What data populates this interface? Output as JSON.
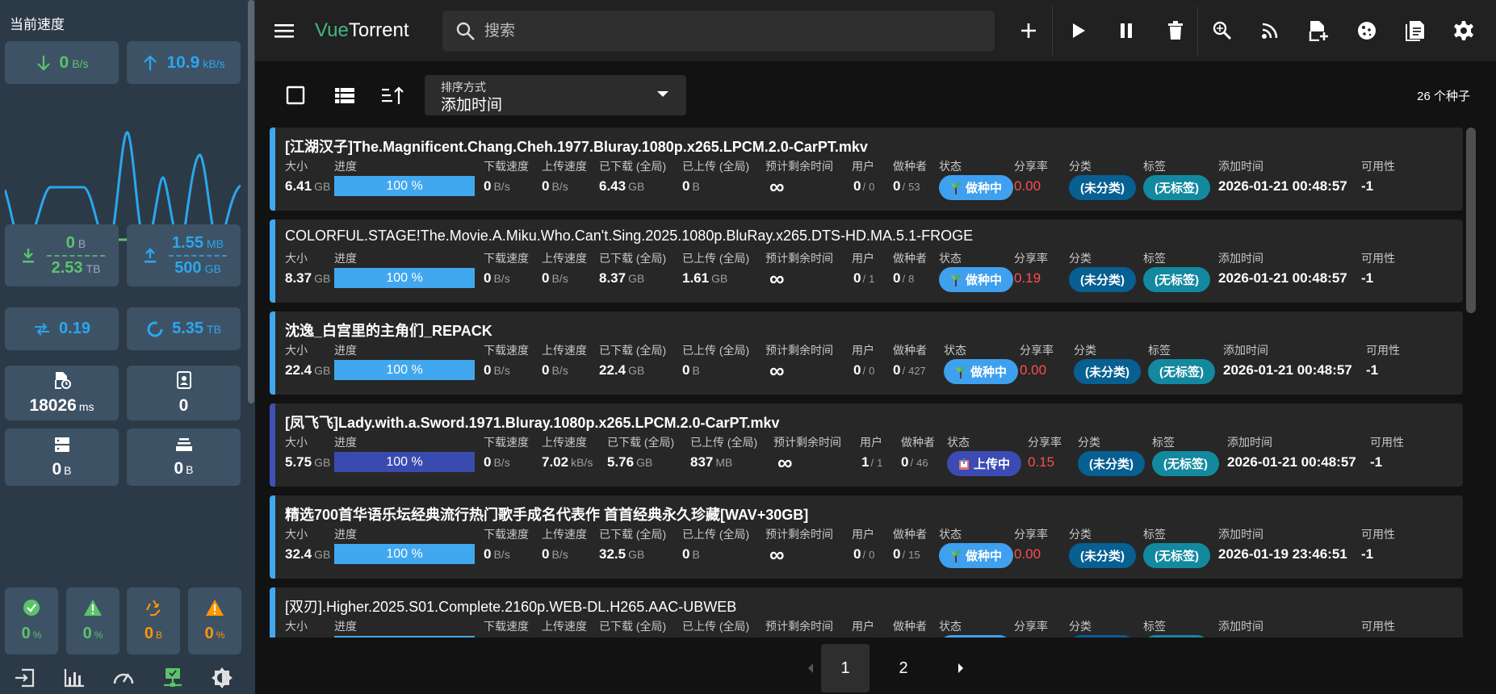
{
  "sidebar": {
    "title": "当前速度",
    "download_speed": {
      "value": "0",
      "unit": "B/s"
    },
    "upload_speed": {
      "value": "10.9",
      "unit": "kB/s"
    },
    "session_download": {
      "session": "0",
      "session_unit": "B",
      "total": "2.53",
      "total_unit": "TB"
    },
    "session_upload": {
      "session": "1.55",
      "session_unit": "MB",
      "total": "500",
      "total_unit": "GB"
    },
    "ratio": "0.19",
    "disk_free": {
      "value": "5.35",
      "unit": "TB"
    },
    "latency": {
      "value": "18026",
      "unit": "ms"
    },
    "peers": "0",
    "cache": {
      "value": "0",
      "unit": "B"
    },
    "queue": {
      "value": "0",
      "unit": "B"
    },
    "small_stats": [
      {
        "icon": "check-circle-icon",
        "value": "0",
        "unit": "%"
      },
      {
        "icon": "warning-icon",
        "value": "0",
        "unit": "%"
      },
      {
        "icon": "recycle-icon",
        "value": "0",
        "unit": "B"
      },
      {
        "icon": "alert-orange-icon",
        "value": "0",
        "unit": "%"
      }
    ],
    "bottom_nav": [
      "logout-icon",
      "chart-icon",
      "speedometer-icon",
      "network-icon",
      "theme-icon"
    ],
    "colors": {
      "download": "#5cc36b",
      "upload": "#2aa7ee",
      "card": "#3e5266"
    }
  },
  "header": {
    "title_vue": "Vue",
    "title_rest": "Torrent",
    "search_placeholder": "搜索",
    "actions": [
      "add-icon",
      "resume-icon",
      "pause-icon",
      "delete-icon",
      "search-plugin-icon",
      "rss-icon",
      "add-file-icon",
      "cookie-icon",
      "log-icon",
      "settings-icon"
    ]
  },
  "toolbar": {
    "sort_label": "排序方式",
    "sort_value": "添加时间",
    "torrent_count": "26 个种子"
  },
  "columns": {
    "size": "大小",
    "progress": "进度",
    "dl_speed": "下载速度",
    "ul_speed": "上传速度",
    "downloaded": "已下载 (全局)",
    "uploaded": "已上传 (全局)",
    "eta": "预计剩余时间",
    "peers": "用户",
    "seeds": "做种者",
    "state": "状态",
    "ratio": "分享率",
    "category": "分类",
    "tags": "标签",
    "added": "添加时间",
    "availability": "可用性"
  },
  "torrents": [
    {
      "name": "[江湖汉子]The.Magnificent.Chang.Cheh.1977.Bluray.1080p.x265.LPCM.2.0-CarPT.mkv",
      "size": "6.41",
      "size_unit": "GB",
      "progress": "100 %",
      "dl": "0",
      "dl_unit": "B/s",
      "ul": "0",
      "ul_unit": "B/s",
      "downloaded": "6.43",
      "downloaded_unit": "GB",
      "uploaded": "0",
      "uploaded_unit": "B",
      "eta": "∞",
      "peers": "0",
      "peers_total": "0",
      "seeds": "0",
      "seeds_total": "53",
      "state": "做种中",
      "ratio": "0.00",
      "category": "(未分类)",
      "tags": "(无标签)",
      "added": "2026-01-21 00:48:57",
      "availability": "-1"
    },
    {
      "name": "COLORFUL.STAGE!The.Movie.A.Miku.Who.Can't.Sing.2025.1080p.BluRay.x265.DTS-HD.MA.5.1-FROGE",
      "size": "8.37",
      "size_unit": "GB",
      "progress": "100 %",
      "dl": "0",
      "dl_unit": "B/s",
      "ul": "0",
      "ul_unit": "B/s",
      "downloaded": "8.37",
      "downloaded_unit": "GB",
      "uploaded": "1.61",
      "uploaded_unit": "GB",
      "eta": "∞",
      "peers": "0",
      "peers_total": "1",
      "seeds": "0",
      "seeds_total": "8",
      "state": "做种中",
      "ratio": "0.19",
      "category": "(未分类)",
      "tags": "(无标签)",
      "added": "2026-01-21 00:48:57",
      "availability": "-1"
    },
    {
      "name": "沈逸_白宫里的主角们_REPACK",
      "size": "22.4",
      "size_unit": "GB",
      "progress": "100 %",
      "dl": "0",
      "dl_unit": "B/s",
      "ul": "0",
      "ul_unit": "B/s",
      "downloaded": "22.4",
      "downloaded_unit": "GB",
      "uploaded": "0",
      "uploaded_unit": "B",
      "eta": "∞",
      "peers": "0",
      "peers_total": "0",
      "seeds": "0",
      "seeds_total": "427",
      "state": "做种中",
      "ratio": "0.00",
      "category": "(未分类)",
      "tags": "(无标签)",
      "added": "2026-01-21 00:48:57",
      "availability": "-1"
    },
    {
      "name": "[凤飞飞]Lady.with.a.Sword.1971.Bluray.1080p.x265.LPCM.2.0-CarPT.mkv",
      "size": "5.75",
      "size_unit": "GB",
      "progress": "100 %",
      "dl": "0",
      "dl_unit": "B/s",
      "ul": "7.02",
      "ul_unit": "kB/s",
      "downloaded": "5.76",
      "downloaded_unit": "GB",
      "uploaded": "837",
      "uploaded_unit": "MB",
      "eta": "∞",
      "peers": "1",
      "peers_total": "1",
      "seeds": "0",
      "seeds_total": "46",
      "state": "上传中",
      "ratio": "0.15",
      "category": "(未分类)",
      "tags": "(无标签)",
      "added": "2026-01-21 00:48:57",
      "availability": "-1"
    },
    {
      "name": "精选700首华语乐坛经典流行热门歌手成名代表作 首首经典永久珍藏[WAV+30GB]",
      "size": "32.4",
      "size_unit": "GB",
      "progress": "100 %",
      "dl": "0",
      "dl_unit": "B/s",
      "ul": "0",
      "ul_unit": "B/s",
      "downloaded": "32.5",
      "downloaded_unit": "GB",
      "uploaded": "0",
      "uploaded_unit": "B",
      "eta": "∞",
      "peers": "0",
      "peers_total": "0",
      "seeds": "0",
      "seeds_total": "15",
      "state": "做种中",
      "ratio": "0.00",
      "category": "(未分类)",
      "tags": "(无标签)",
      "added": "2026-01-19 23:46:51",
      "availability": "-1"
    },
    {
      "name": "[双刃].Higher.2025.S01.Complete.2160p.WEB-DL.H265.AAC-UBWEB"
    }
  ],
  "pagination": {
    "pages": [
      "1",
      "2"
    ],
    "current": "1"
  }
}
